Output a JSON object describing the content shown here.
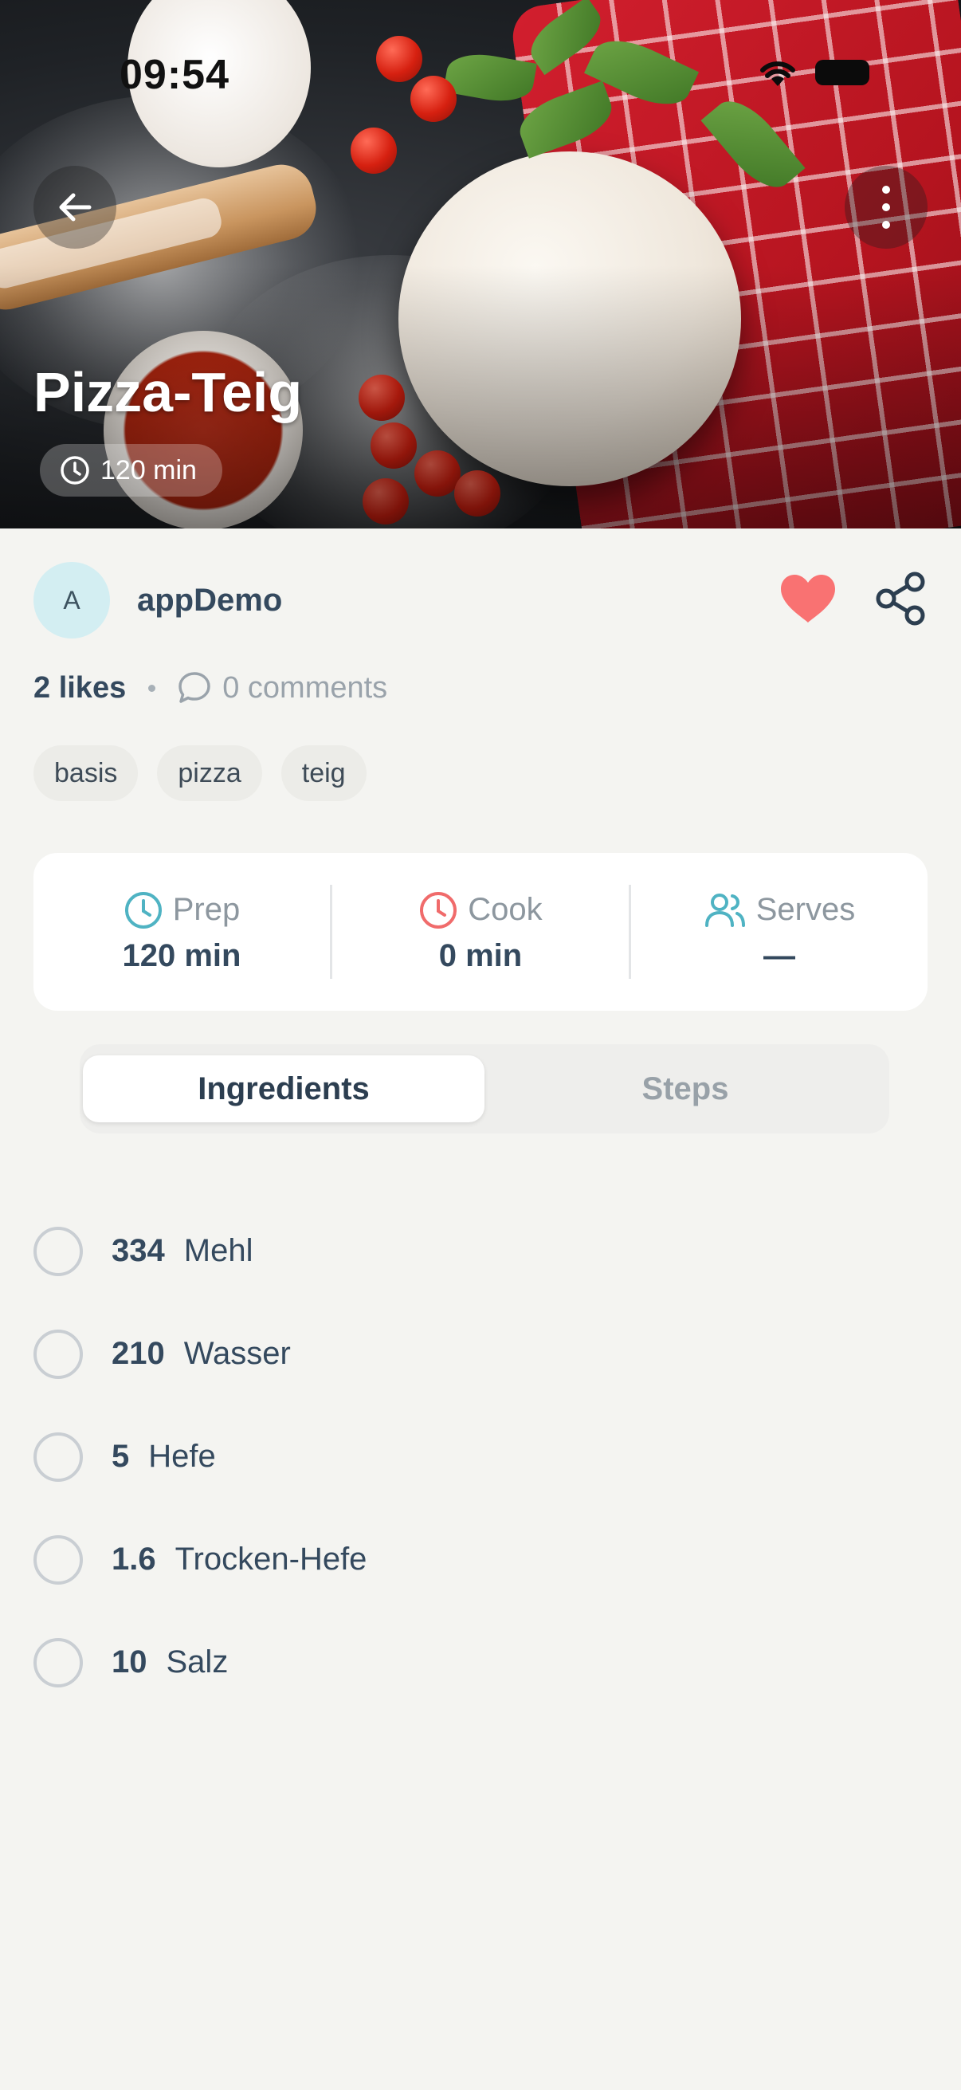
{
  "status_bar": {
    "time": "09:54"
  },
  "hero": {
    "title": "Pizza-Teig",
    "time_chip": "120 min"
  },
  "author": {
    "avatar_initial": "A",
    "name": "appDemo"
  },
  "stats": {
    "likes": "2 likes",
    "comments": "0 comments"
  },
  "tags": [
    "basis",
    "pizza",
    "teig"
  ],
  "info": {
    "prep_label": "Prep",
    "prep_value": "120 min",
    "cook_label": "Cook",
    "cook_value": "0 min",
    "serves_label": "Serves",
    "serves_value": "—"
  },
  "tabs": {
    "ingredients": "Ingredients",
    "steps": "Steps",
    "active": "Ingredients"
  },
  "ingredients": [
    {
      "qty": "334",
      "name": "Mehl"
    },
    {
      "qty": "210",
      "name": "Wasser"
    },
    {
      "qty": "5",
      "name": "Hefe"
    },
    {
      "qty": "1.6",
      "name": "Trocken-Hefe"
    },
    {
      "qty": "10",
      "name": "Salz"
    }
  ],
  "colors": {
    "heart": "#f97272",
    "accent_teal": "#4fb3c3",
    "accent_red": "#f06b6b",
    "background": "#f4f4f1"
  },
  "icons": [
    "wifi-icon",
    "battery-icon",
    "back-arrow-icon",
    "more-vertical-icon",
    "clock-icon",
    "heart-icon",
    "share-icon",
    "comment-icon",
    "users-icon"
  ]
}
